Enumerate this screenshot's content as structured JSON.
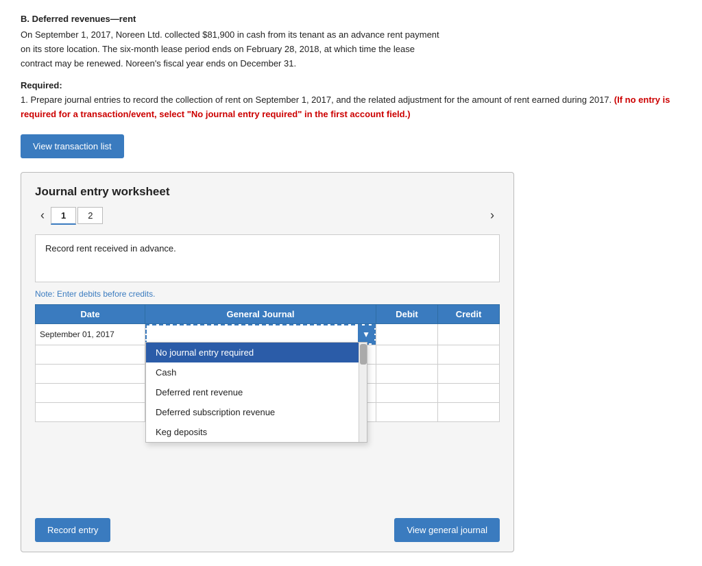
{
  "section": {
    "title": "B. Deferred revenues—rent",
    "description_line1": "On September 1, 2017, Noreen Ltd. collected $81,900 in cash from its tenant as an advance rent payment",
    "description_line2": "on its store location. The six-month lease period ends on February 28, 2018, at which time the lease",
    "description_line3": "contract may be renewed. Noreen's fiscal year ends on December 31.",
    "required_label": "Required:",
    "instruction": "1. Prepare journal entries to record the collection of rent on September 1, 2017, and the related adjustment for the amount of rent earned during 2017.",
    "instruction_red": "(If no entry is required for a transaction/event, select \"No journal entry required\" in the first account field.)"
  },
  "view_transaction_btn": "View transaction list",
  "worksheet": {
    "title": "Journal entry worksheet",
    "tabs": [
      {
        "label": "1",
        "active": true
      },
      {
        "label": "2",
        "active": false
      }
    ],
    "description": "Record rent received in advance.",
    "note": "Note: Enter debits before credits.",
    "table": {
      "headers": [
        "Date",
        "General Journal",
        "Debit",
        "Credit"
      ],
      "rows": [
        {
          "date": "September 01, 2017",
          "general_journal": "",
          "debit": "",
          "credit": ""
        },
        {
          "date": "",
          "general_journal": "",
          "debit": "",
          "credit": ""
        },
        {
          "date": "",
          "general_journal": "",
          "debit": "",
          "credit": ""
        },
        {
          "date": "",
          "general_journal": "",
          "debit": "",
          "credit": ""
        },
        {
          "date": "",
          "general_journal": "",
          "debit": "",
          "credit": ""
        }
      ]
    },
    "dropdown": {
      "items": [
        {
          "label": "No journal entry required",
          "selected": true
        },
        {
          "label": "Cash",
          "selected": false
        },
        {
          "label": "Deferred rent revenue",
          "selected": false
        },
        {
          "label": "Deferred subscription revenue",
          "selected": false
        },
        {
          "label": "Keg deposits",
          "selected": false
        }
      ]
    },
    "record_btn": "Record entry",
    "view_general_btn": "View general journal"
  }
}
